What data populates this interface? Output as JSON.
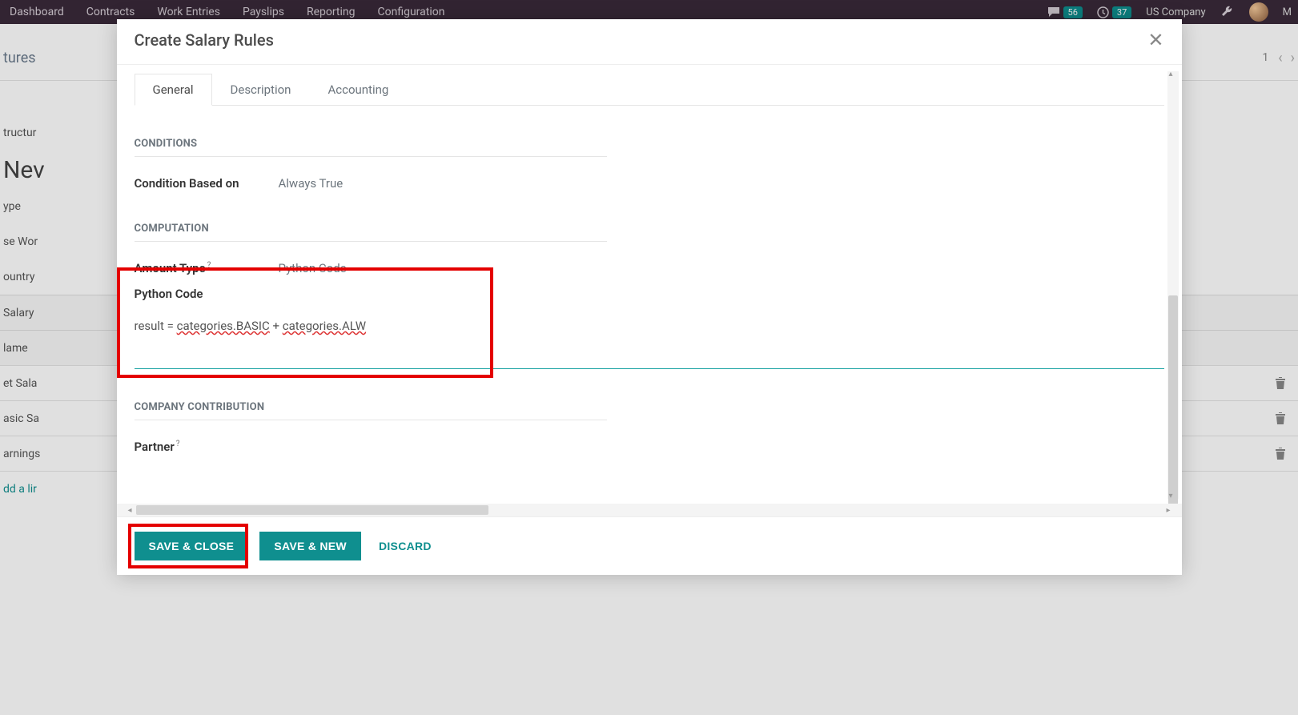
{
  "navbar": {
    "items": [
      "Dashboard",
      "Contracts",
      "Work Entries",
      "Payslips",
      "Reporting",
      "Configuration"
    ],
    "msg_badge": "56",
    "clock_badge": "37",
    "company": "US Company",
    "user_initial": "M"
  },
  "bg": {
    "breadcrumb": "tures",
    "structure_label": "tructur",
    "new_label": "Nev",
    "type_label": "ype",
    "use_worked_label": "se Wor",
    "country_label": "ountry",
    "salary_label": "Salary",
    "name_label": "lame",
    "net_label": "et Sala",
    "basic_label": "asic Sa",
    "earnings_label": "arnings",
    "addline_label": "dd a lir",
    "pager": "1"
  },
  "modal": {
    "title": "Create Salary Rules",
    "tabs": {
      "general": "General",
      "description": "Description",
      "accounting": "Accounting"
    },
    "sections": {
      "conditions": "CONDITIONS",
      "computation": "COMPUTATION",
      "company_contribution": "COMPANY CONTRIBUTION"
    },
    "fields": {
      "condition_based_on": {
        "label": "Condition Based on",
        "value": "Always True"
      },
      "amount_type": {
        "label": "Amount Type",
        "value": "Python Code"
      },
      "python_code": {
        "label": "Python Code"
      },
      "partner": {
        "label": "Partner"
      }
    },
    "code": {
      "prefix": "result = ",
      "seg1": "categories.BASIC",
      "plus": " + ",
      "seg2": "categories.ALW"
    },
    "buttons": {
      "save_close": "SAVE & CLOSE",
      "save_new": "SAVE & NEW",
      "discard": "DISCARD"
    }
  }
}
